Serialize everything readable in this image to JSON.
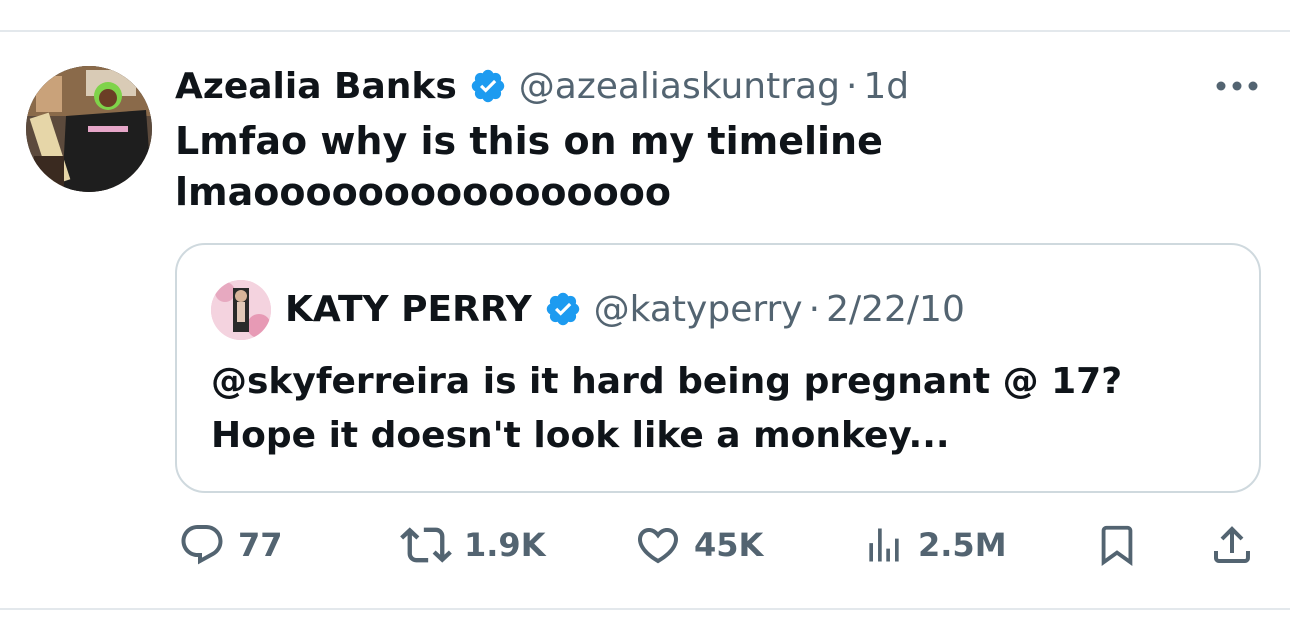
{
  "tweet": {
    "display_name": "Azealia Banks",
    "handle": "@azealiaskuntrag",
    "separator": "·",
    "time": "1d",
    "text_lines": [
      "Lmfao why is this on my timeline",
      "lmaoooooooooooooooo"
    ],
    "more_icon": "more-horizontal-icon",
    "verified_icon": "verified-badge-icon"
  },
  "quote": {
    "display_name": "KATY PERRY",
    "handle": "@katyperry",
    "separator": "·",
    "time": "2/22/10",
    "text_lines": [
      "@skyferreira is it hard being pregnant @ 17?",
      "Hope it doesn't look like a monkey..."
    ],
    "verified_icon": "verified-badge-icon"
  },
  "actions": {
    "reply": {
      "icon": "reply-icon",
      "count": "77"
    },
    "retweet": {
      "icon": "retweet-icon",
      "count": "1.9K"
    },
    "like": {
      "icon": "heart-icon",
      "count": "45K"
    },
    "views": {
      "icon": "views-chart-icon",
      "count": "2.5M"
    },
    "bookmark": {
      "icon": "bookmark-icon"
    },
    "share": {
      "icon": "share-icon"
    }
  },
  "colors": {
    "verified_blue": "#1d9bf0",
    "primary_text": "#0f1419",
    "secondary_text": "#536471",
    "border": "#cfd9de"
  }
}
